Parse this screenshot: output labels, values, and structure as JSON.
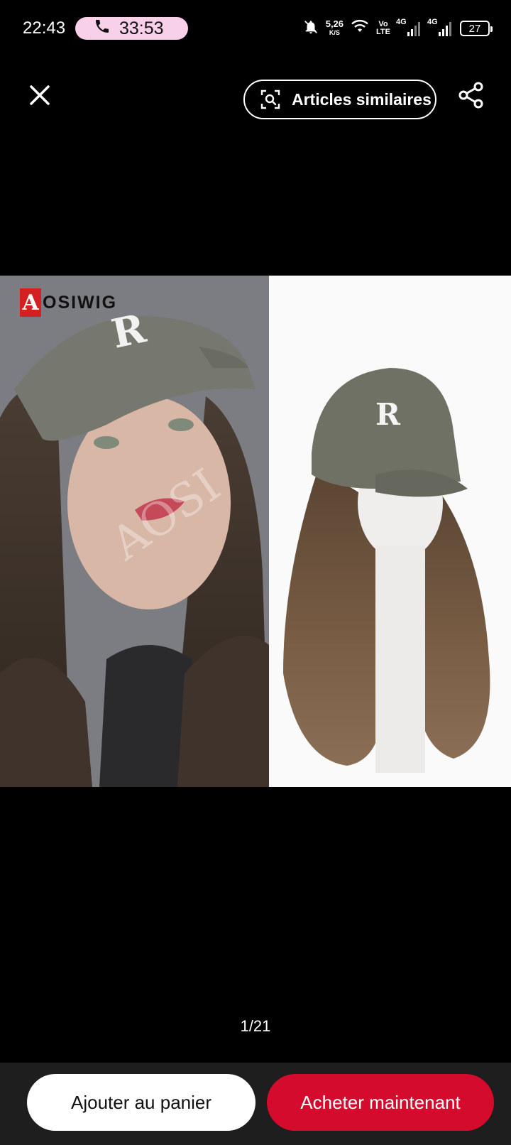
{
  "status_bar": {
    "time": "22:43",
    "call_timer": "33:53",
    "net_speed_value": "5,26",
    "net_speed_unit": "K/S",
    "volte_top": "Vo",
    "volte_bottom": "LTE",
    "sim1_label": "4G",
    "sim2_label": "4G",
    "battery_level": "27"
  },
  "top_bar": {
    "similar_label": "Articles similaires"
  },
  "product_image": {
    "brand_badge": "A",
    "brand_text": "OSIWIG",
    "watermark": "AOSI"
  },
  "gallery": {
    "page_indicator": "1/21"
  },
  "bottom_bar": {
    "add_to_cart_label": "Ajouter au panier",
    "buy_now_label": "Acheter maintenant"
  },
  "colors": {
    "buy_button": "#d50b2d",
    "call_pill": "#f8d0ea"
  }
}
